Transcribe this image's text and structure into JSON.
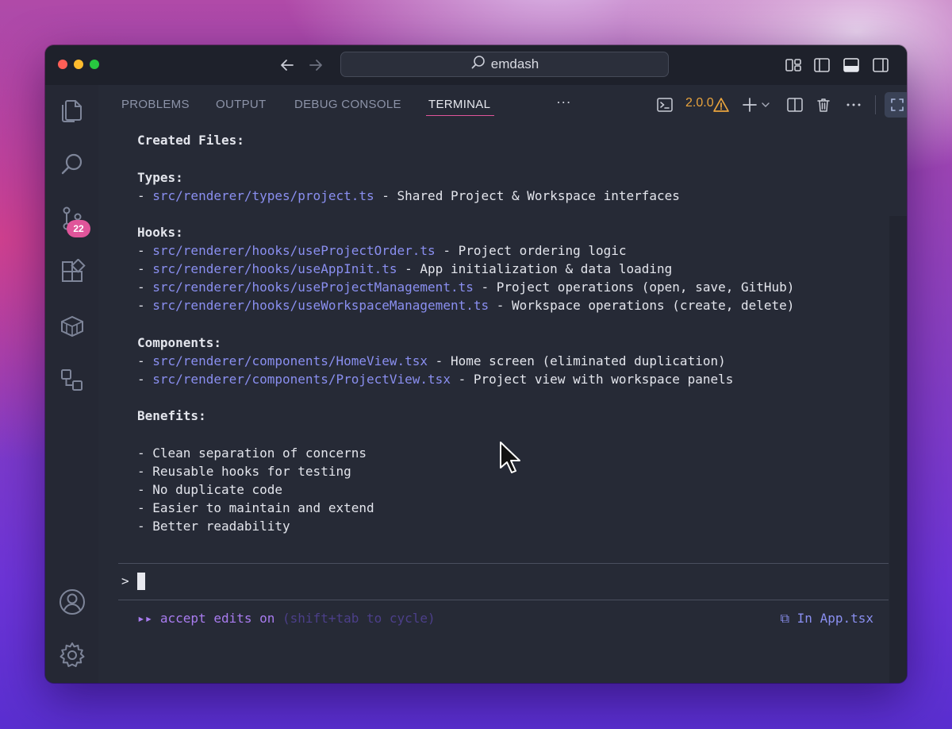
{
  "window": {
    "search_text": "emdash"
  },
  "activity_bar": {
    "items": [
      {
        "name": "explorer-icon"
      },
      {
        "name": "search-icon"
      },
      {
        "name": "source-control-icon"
      },
      {
        "name": "extensions-icon"
      },
      {
        "name": "packages-icon"
      },
      {
        "name": "remote-explorer-icon"
      }
    ],
    "source_control_badge": "22",
    "bottom": [
      {
        "name": "account-icon"
      },
      {
        "name": "settings-gear-icon"
      }
    ]
  },
  "panel": {
    "tabs": [
      {
        "label": "PROBLEMS",
        "active": false
      },
      {
        "label": "OUTPUT",
        "active": false
      },
      {
        "label": "DEBUG CONSOLE",
        "active": false
      },
      {
        "label": "TERMINAL",
        "active": true
      }
    ],
    "more_label": "···",
    "terminal_version": "2.0.0",
    "accent_color": "#e0559a",
    "warning_color": "#e8a33d"
  },
  "terminal": {
    "created_files": "Created Files:",
    "types_heading": "Types:",
    "types": [
      {
        "prefix": "- ",
        "path": "src/renderer/types/project.ts",
        "desc": " - Shared Project & Workspace interfaces"
      }
    ],
    "hooks_heading": "Hooks:",
    "hooks": [
      {
        "prefix": "- ",
        "path": "src/renderer/hooks/useProjectOrder.ts",
        "desc": " - Project ordering logic"
      },
      {
        "prefix": "- ",
        "path": "src/renderer/hooks/useAppInit.ts",
        "desc": " - App initialization & data loading"
      },
      {
        "prefix": "- ",
        "path": "src/renderer/hooks/useProjectManagement.ts",
        "desc": " - Project operations (open, save, GitHub)"
      },
      {
        "prefix": "- ",
        "path": "src/renderer/hooks/useWorkspaceManagement.ts",
        "desc": " - Workspace operations (create, delete)"
      }
    ],
    "components_heading": "Components:",
    "components": [
      {
        "prefix": "- ",
        "path": "src/renderer/components/HomeView.tsx",
        "desc": " - Home screen (eliminated duplication)"
      },
      {
        "prefix": "- ",
        "path": "src/renderer/components/ProjectView.tsx",
        "desc": " - Project view with workspace panels"
      }
    ],
    "benefits_heading": "Benefits:",
    "benefits": [
      "- Clean separation of concerns",
      "- Reusable hooks for testing",
      "- No duplicate code",
      "- Easier to maintain and extend",
      "- Better readability"
    ],
    "prompt_symbol": ">",
    "status_arrows": "▸▸",
    "status_mode": " accept edits on ",
    "status_hint": "(shift+tab to cycle)",
    "status_file": "⧉ In App.tsx",
    "path_color": "#8a8ff0"
  }
}
